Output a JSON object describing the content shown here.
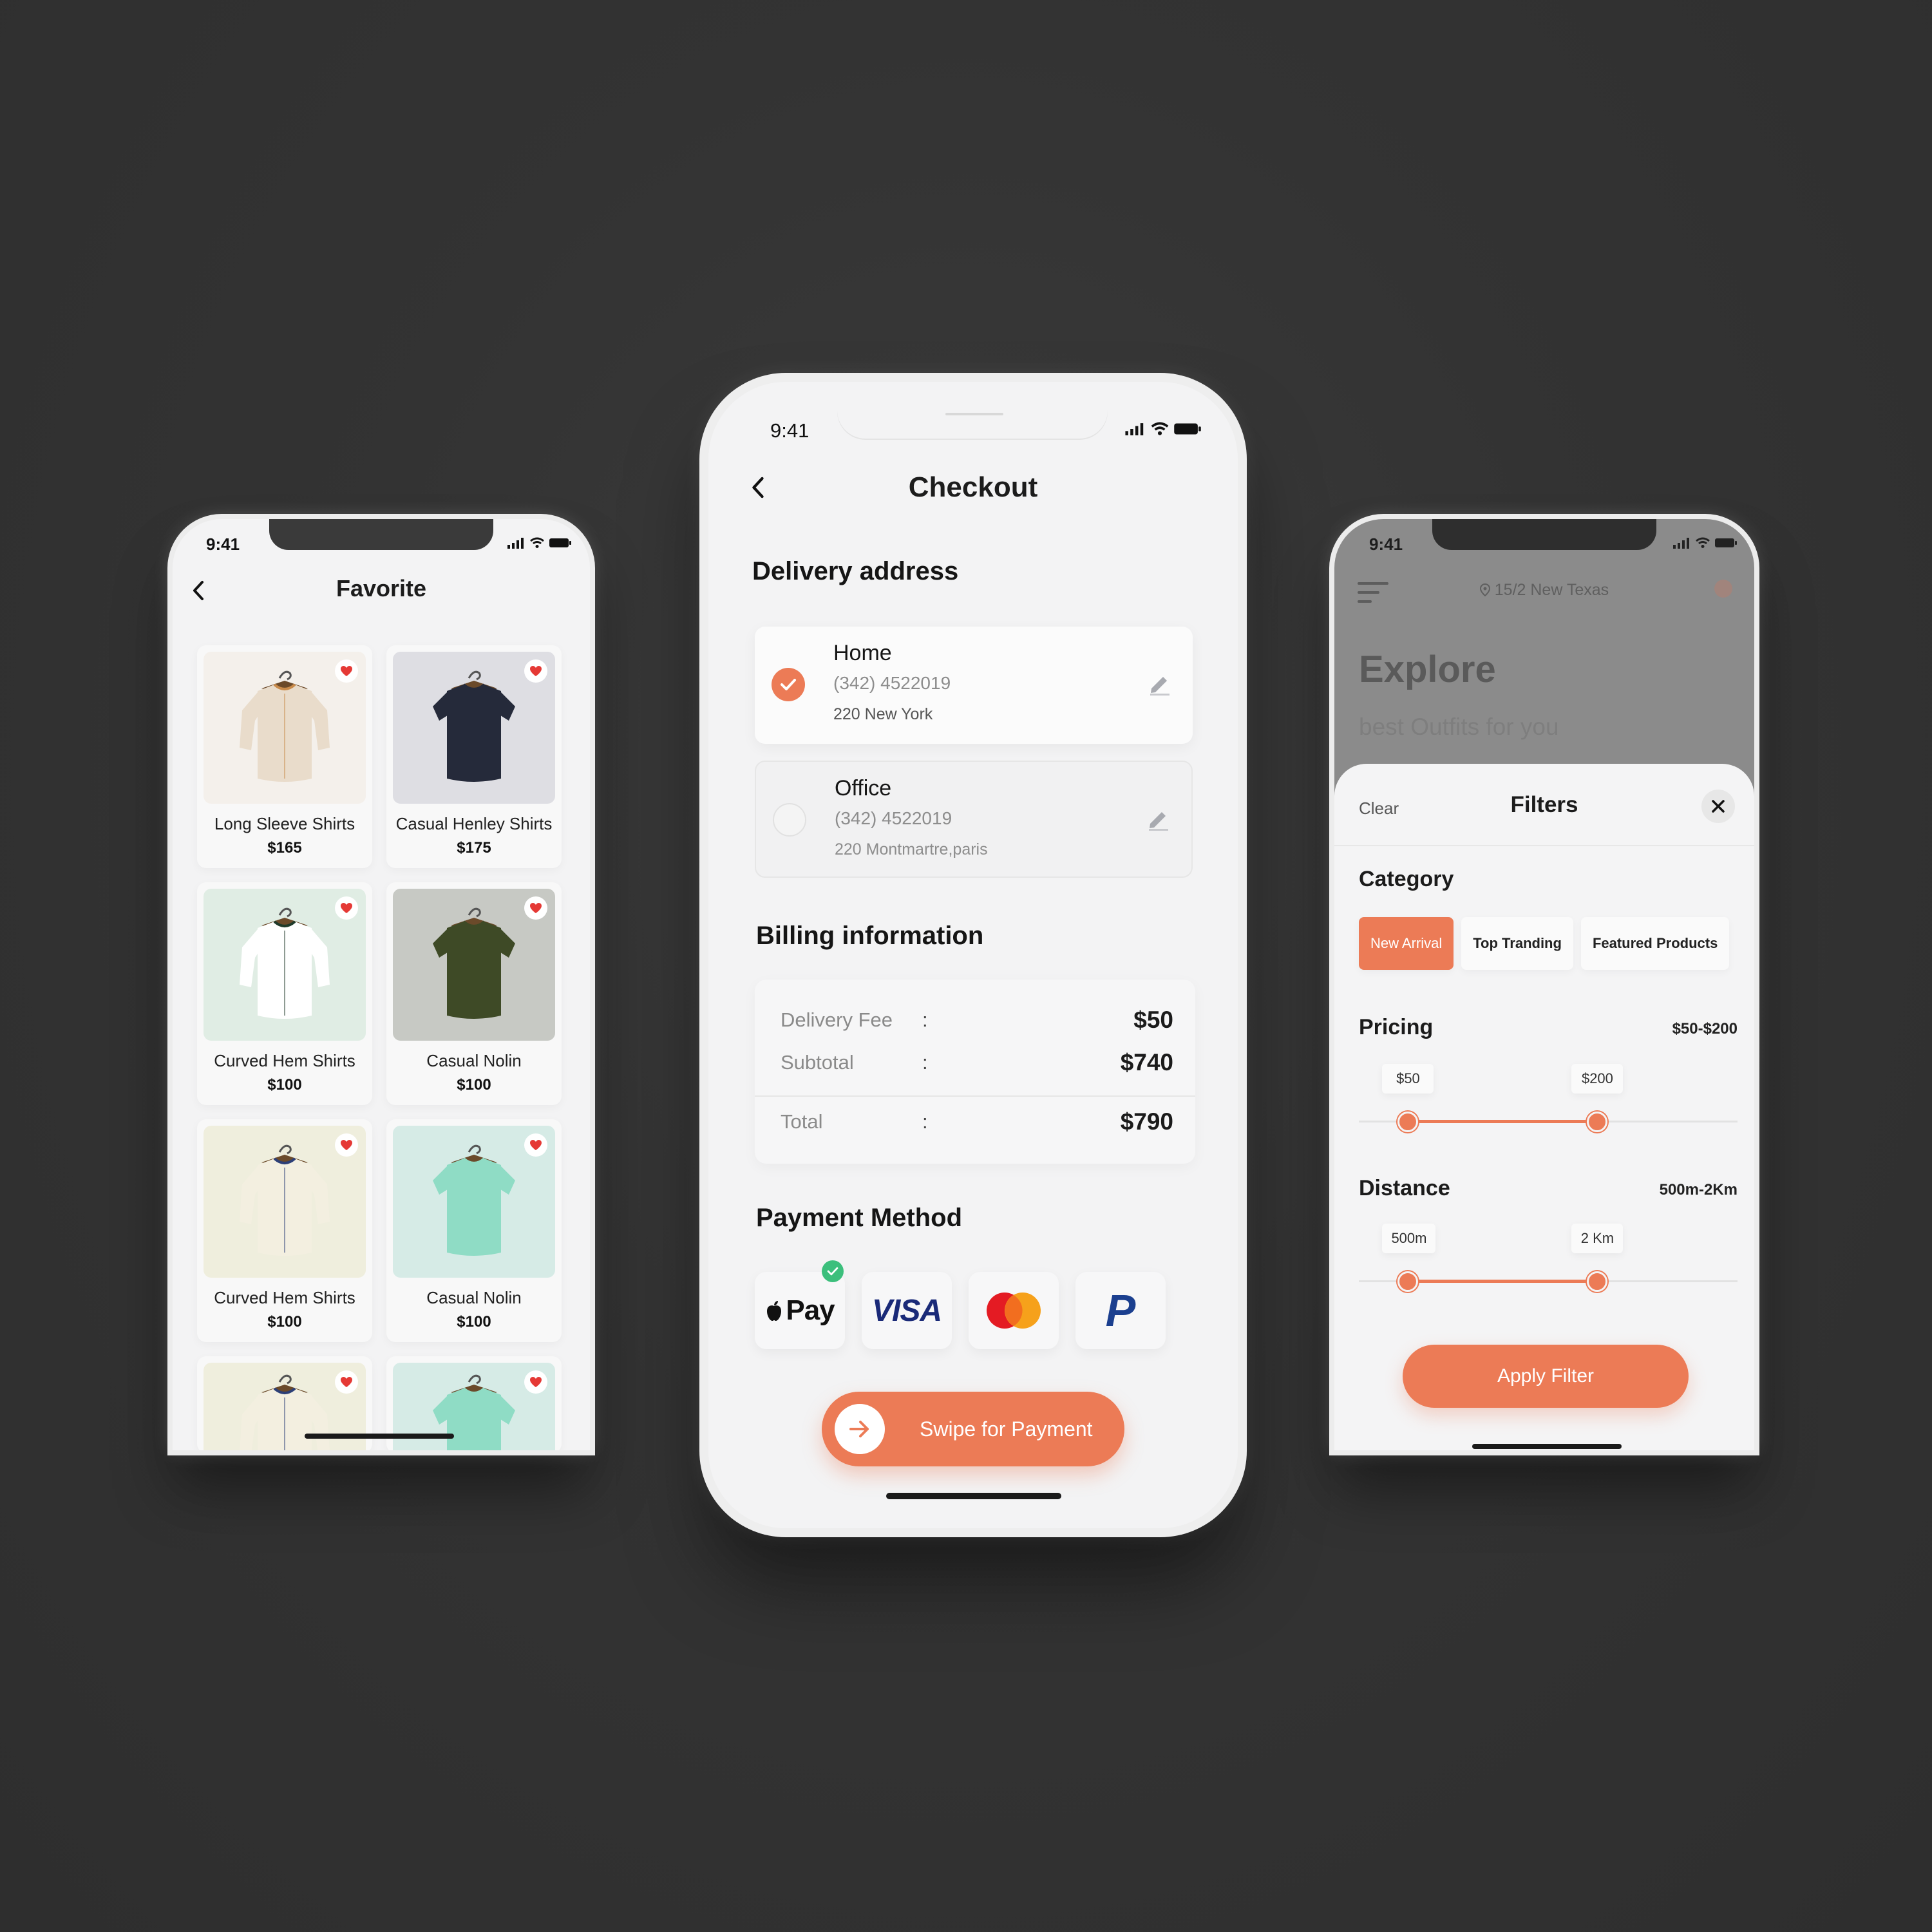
{
  "favorite_screen": {
    "status_time": "9:41",
    "title": "Favorite",
    "items": [
      {
        "name": "Long Sleeve Shirts",
        "price": "$165",
        "bg": "#f4f0eb",
        "shirt": "#e9dccb",
        "accent": "#c98b4b"
      },
      {
        "name": "Casual Henley Shirts",
        "price": "$175",
        "bg": "#dedee3",
        "shirt": "#252a3a",
        "accent": "#252a3a"
      },
      {
        "name": "Curved Hem Shirts",
        "price": "$100",
        "bg": "#e0ede4",
        "shirt": "#ffffff",
        "accent": "#1f3a2a"
      },
      {
        "name": "Casual Nolin",
        "price": "$100",
        "bg": "#c7c9c4",
        "shirt": "#3e4a26",
        "accent": "#3e4a26"
      },
      {
        "name": "Curved Hem Shirts",
        "price": "$100",
        "bg": "#efeedd",
        "shirt": "#f3efe0",
        "accent": "#2c3f77"
      },
      {
        "name": "Casual Nolin",
        "price": "$100",
        "bg": "#d6ebe6",
        "shirt": "#8fdcc5",
        "accent": "#8fdcc5"
      }
    ],
    "partial_items": [
      {
        "bg": "#efeedd",
        "shirt": "#f3efe0",
        "accent": "#2c3f77"
      },
      {
        "bg": "#d6ebe6",
        "shirt": "#8fdcc5",
        "accent": "#8fdcc5"
      }
    ]
  },
  "checkout_screen": {
    "status_time": "9:41",
    "title": "Checkout",
    "delivery_title": "Delivery address",
    "addresses": [
      {
        "name": "Home",
        "phone": "(342)  4522019",
        "line": "220  New York",
        "selected": true
      },
      {
        "name": "Office",
        "phone": "(342)  4522019",
        "line": "220  Montmartre,paris",
        "selected": false
      }
    ],
    "billing_title": "Billing information",
    "billing": [
      {
        "label": "Delivery Fee",
        "colon": ":",
        "value": "$50"
      },
      {
        "label": "Subtotal",
        "colon": ":",
        "value": "$740"
      },
      {
        "label": "Total",
        "colon": ":",
        "value": "$790"
      }
    ],
    "payment_title": "Payment Method",
    "payment_methods": [
      {
        "name": "Apple Pay",
        "text": "Pay",
        "selected": true
      },
      {
        "name": "Visa",
        "text": "VISA",
        "selected": false
      },
      {
        "name": "Mastercard",
        "text": "",
        "selected": false
      },
      {
        "name": "PayPal",
        "text": "P",
        "selected": false
      }
    ],
    "swipe_label": "Swipe for Payment"
  },
  "filter_screen": {
    "status_time": "9:41",
    "location": "15/2 New Texas",
    "explore_title": "Explore",
    "explore_subtitle": "best Outfits for you",
    "clear_label": "Clear",
    "sheet_title": "Filters",
    "category_label": "Category",
    "categories": [
      {
        "label": "New Arrival",
        "active": true
      },
      {
        "label": "Top Tranding",
        "active": false
      },
      {
        "label": "Featured Products",
        "active": false
      }
    ],
    "pricing_label": "Pricing",
    "pricing_range": "$50-$200",
    "pricing_min_label": "$50",
    "pricing_max_label": "$200",
    "pricing_min_fraction": 0.13,
    "pricing_max_fraction": 0.63,
    "distance_label": "Distance",
    "distance_range": "500m-2Km",
    "distance_min_label": "500m",
    "distance_max_label": "2 Km",
    "distance_min_fraction": 0.13,
    "distance_max_fraction": 0.63,
    "apply_label": "Apply Filter"
  },
  "colors": {
    "accent": "#ec7b56",
    "success": "#3cbf7c",
    "heart": "#e53935",
    "background": "#333333"
  }
}
